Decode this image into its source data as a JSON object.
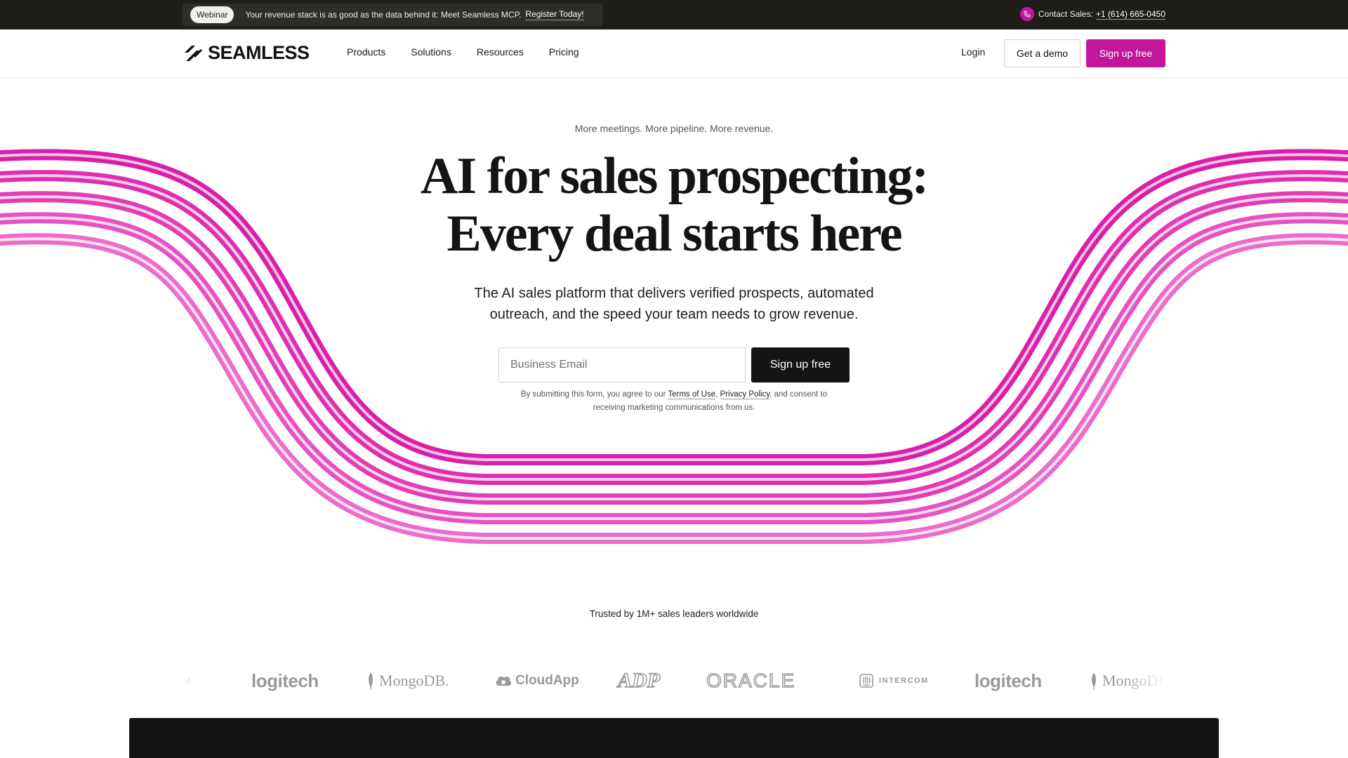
{
  "announcement": {
    "badge": "Webinar",
    "text": "Your revenue stack is as good as the data behind it: Meet Seamless MCP.",
    "link": "Register Today!",
    "contact_label": "Contact Sales:",
    "contact_phone": "+1 (614) 665-0450"
  },
  "nav": {
    "logo_text": "SEAMLESS",
    "menu": [
      "Products",
      "Solutions",
      "Resources",
      "Pricing"
    ],
    "login": "Login",
    "demo": "Get a demo",
    "signup": "Sign up free"
  },
  "hero": {
    "eyebrow": "More meetings. More pipeline. More revenue.",
    "headline_line1": "AI for sales prospecting:",
    "headline_line2": "Every deal starts here",
    "sub_line1": "The AI sales platform that delivers verified prospects, automated",
    "sub_line2": "outreach, and the speed your team needs to grow revenue.",
    "email_placeholder": "Business Email",
    "cta": "Sign up free",
    "legal_prefix": "By submitting this form, you agree to our",
    "legal_terms": "Terms of Use",
    "legal_comma": ",",
    "legal_privacy": "Privacy Policy",
    "legal_suffix": ", and consent to",
    "legal_line2": "receiving marketing communications from us."
  },
  "trusted": {
    "text": "Trusted by 1M+ sales leaders worldwide",
    "logos": [
      "OM",
      "logitech",
      "MongoDB.",
      "CloudApp",
      "ADP",
      "ORACLE",
      "INTERCOM",
      "logitech",
      "MongoDB"
    ]
  },
  "colors": {
    "brand": "#c2169b",
    "dark": "#1f1d1a"
  }
}
